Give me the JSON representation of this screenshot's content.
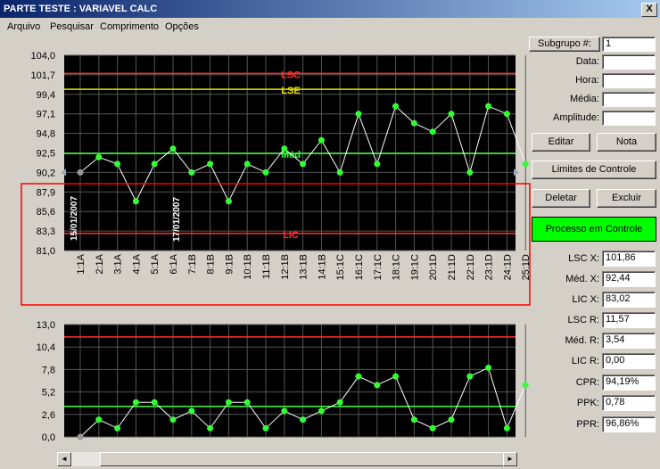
{
  "window": {
    "title": "PARTE TESTE : VARIAVEL CALC",
    "close_label": "X"
  },
  "menu": [
    "Arquivo",
    "Pesquisar",
    "Comprimento",
    "Opções"
  ],
  "upper_chart": {
    "yticks": [
      "104,0",
      "101,7",
      "99,4",
      "97,1",
      "94,8",
      "92,5",
      "90,2",
      "87,9",
      "85,6",
      "83,3",
      "81,0"
    ],
    "lines": {
      "lsc": "LSC",
      "lse": "LSE",
      "med": "Méd",
      "lic": "LIC"
    },
    "date_labels": [
      "15/01/2007",
      "17/01/2007"
    ]
  },
  "lower_chart": {
    "yticks": [
      "13,0",
      "10,4",
      "7,8",
      "5,2",
      "2,6",
      "0,0"
    ]
  },
  "chart_data": [
    {
      "type": "line",
      "title": "",
      "categories": [
        "1:1A",
        "2:1A",
        "3:1A",
        "4:1A",
        "5:1A",
        "6:1A",
        "7:1B",
        "8:1B",
        "9:1B",
        "10:1B",
        "11:1B",
        "12:1B",
        "13:1B",
        "14:1B",
        "15:1C",
        "16:1C",
        "17:1C",
        "18:1C",
        "19:1C",
        "20:1D",
        "21:1D",
        "22:1D",
        "23:1D",
        "24:1D",
        "25:1D"
      ],
      "values": [
        90.2,
        92.0,
        91.2,
        86.8,
        91.2,
        93.0,
        90.2,
        91.2,
        86.8,
        91.2,
        90.2,
        93.0,
        91.2,
        94.0,
        90.2,
        97.1,
        91.2,
        98.0,
        96.0,
        95.0,
        97.1,
        90.2,
        98.0,
        97.1,
        91.2
      ],
      "limits": {
        "LSC": 101.86,
        "LSE": 100.0,
        "Méd": 92.44,
        "LIC": 83.02
      },
      "ylim": [
        81.0,
        104.0
      ],
      "grid": true,
      "background": "#000000",
      "point_color": "#33ff33",
      "colors": {
        "lsc": "#ff3030",
        "lse": "#e6e000",
        "med": "#33ff33",
        "lic": "#ff3030"
      }
    },
    {
      "type": "line",
      "title": "",
      "values": [
        0.0,
        2.0,
        1.0,
        4.0,
        4.0,
        2.0,
        3.0,
        1.0,
        4.0,
        4.0,
        1.0,
        3.0,
        2.0,
        3.0,
        4.0,
        7.0,
        6.0,
        7.0,
        2.0,
        1.0,
        2.0,
        7.0,
        8.0,
        1.0,
        6.0
      ],
      "limits": {
        "LSC R": 11.57,
        "Méd. R": 3.54,
        "LIC R": 0.0
      },
      "ylim": [
        0.0,
        13.0
      ],
      "grid": true,
      "background": "#000000",
      "point_color": "#33ff33"
    }
  ],
  "side": {
    "subgroup_button": "Subgrupo #:",
    "subgroup_value": "1",
    "fields": [
      {
        "label": "Data:",
        "value": ""
      },
      {
        "label": "Hora:",
        "value": ""
      },
      {
        "label": "Média:",
        "value": ""
      },
      {
        "label": "Amplitude:",
        "value": ""
      }
    ],
    "buttons": {
      "editar": "Editar",
      "nota": "Nota",
      "limites": "Limites de Controle",
      "deletar": "Deletar",
      "excluir": "Excluir"
    },
    "status": "Processo em Controle",
    "stats": [
      {
        "label": "LSC X:",
        "value": "101,86"
      },
      {
        "label": "Méd. X:",
        "value": "92,44"
      },
      {
        "label": "LIC X:",
        "value": "83,02"
      },
      {
        "label": "LSC R:",
        "value": "11,57"
      },
      {
        "label": "Méd. R:",
        "value": "3,54"
      },
      {
        "label": "LIC R:",
        "value": "0,00"
      },
      {
        "label": "CPR:",
        "value": "94,19%"
      },
      {
        "label": "PPK:",
        "value": "0,78"
      },
      {
        "label": "PPR:",
        "value": "96,86%"
      }
    ]
  },
  "scrollbar": {
    "left_arrow": "◄",
    "right_arrow": "►"
  }
}
